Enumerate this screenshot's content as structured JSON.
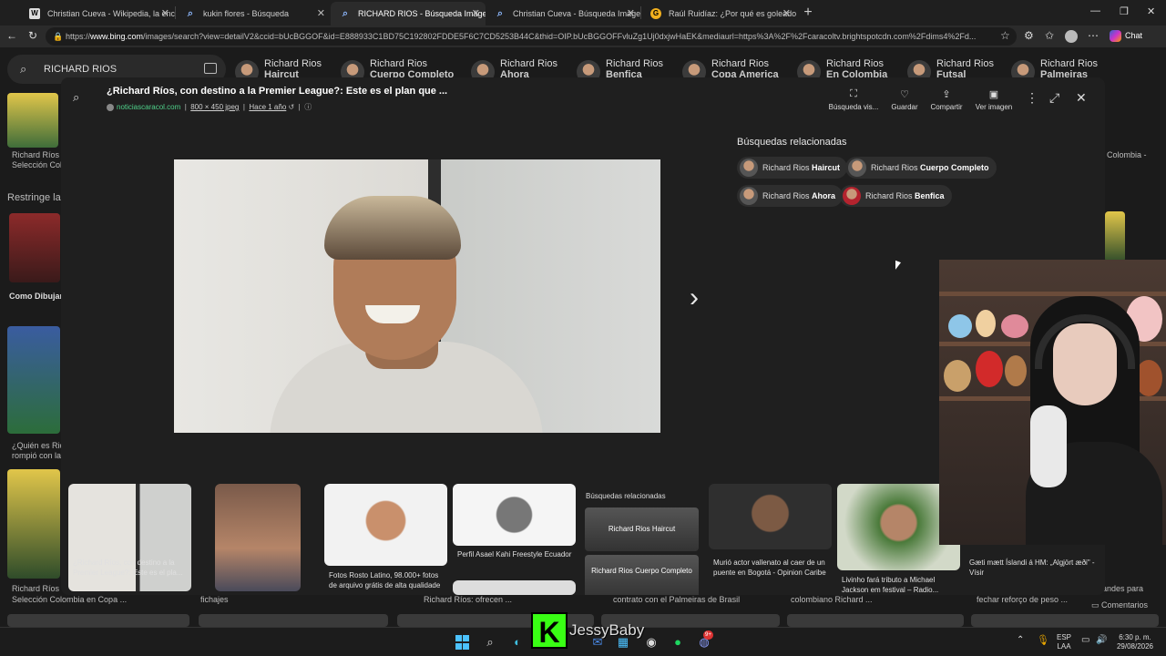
{
  "tabs": [
    {
      "label": "Christian Cueva - Wikipedia, la enc",
      "favicon": "W"
    },
    {
      "label": "kukin flores - Búsqueda",
      "favicon": "search-icon"
    },
    {
      "label": "RICHARD RIOS - Búsqueda Imágen",
      "favicon": "search-icon",
      "active": true
    },
    {
      "label": "Christian Cueva - Búsqueda Imáge",
      "favicon": "search-icon"
    },
    {
      "label": "Raúl Ruidíaz: ¿Por qué es goleador",
      "favicon": "gold"
    }
  ],
  "address": {
    "url_prefix": "https://",
    "url_host": "www.bing.com",
    "url_rest": "/images/search?view=detailV2&ccid=bUcBGGOF&id=E888933C1BD75C192802FDDE5F6C7CD5253B44C&thid=OIP.bUcBGGOFFvluZg1Uj0dxjwHaEK&mediaurl=https%3A%2F%2Fcaracoltv.brightspotcdn.com%2Fdims4%2Fd..."
  },
  "copilot_label": "Chat",
  "bing": {
    "query": "RICHARD RIOS",
    "chips": [
      {
        "name": "Richard Rios",
        "sub": "Haircut"
      },
      {
        "name": "Richard Rios",
        "sub": "Cuerpo Completo"
      },
      {
        "name": "Richard Rios",
        "sub": "Ahora"
      },
      {
        "name": "Richard Rios",
        "sub": "Benfica"
      },
      {
        "name": "Richard Rios",
        "sub": "Copa America"
      },
      {
        "name": "Richard Rios",
        "sub": "En Colombia"
      },
      {
        "name": "Richard Rios",
        "sub": "Futsal"
      },
      {
        "name": "Richard Rios",
        "sub": "Palmeiras"
      }
    ],
    "bg_texts": {
      "left1": "Richard Ríos",
      "left2": "Selección Col",
      "restrict": "Restringe la",
      "como": "Como Dibujar",
      "quien1": "¿Quién es Ric",
      "quien2": "rompió con la",
      "bottom1": "Richard Ríos",
      "bottom2": "Selección Colombia en Copa ...",
      "bottom3": "fichajes",
      "bottom4": "Richard Ríos: ofrecen ...",
      "bottom5": "contrato con el Palmeiras de Brasil",
      "bottom6": "colombiano Richard ...",
      "bottom7": "fechar reforço de peso ...",
      "right1": "Colombia -",
      "right2": "andes para",
      "comentarios": "Comentarios"
    }
  },
  "modal": {
    "title": "¿Richard Ríos, con destino a la Premier League?: Este es el plan que ...",
    "source": "noticiascaracol.com",
    "dims": "800 × 450 jpeg",
    "age": "Hace 1 año",
    "actions": [
      {
        "label": "Búsqueda vis...",
        "icon": "visual-search-icon"
      },
      {
        "label": "Guardar",
        "icon": "save-icon"
      },
      {
        "label": "Compartir",
        "icon": "share-icon"
      },
      {
        "label": "Ver imagen",
        "icon": "view-image-icon"
      }
    ],
    "related_title": "Búsquedas relacionadas",
    "related": [
      {
        "name": "Richard Rios",
        "sub": "Haircut"
      },
      {
        "name": "Richard Rios",
        "sub": "Cuerpo Completo"
      },
      {
        "name": "Richard Rios",
        "sub": "Ahora"
      },
      {
        "name": "Richard Rios",
        "sub": "Benfica"
      }
    ],
    "strip": [
      {
        "caption": "¿Richard Ríos, con destino a la Premier League?: Este es el pla..."
      },
      {
        "caption": ""
      },
      {
        "caption": "Fotos Rosto Latino, 98.000+ fotos de arquivo grátis de alta qualidade"
      },
      {
        "caption": "Perfil Asael Kahi Freestyle Ecuador"
      },
      {
        "caption": "Murió actor vallenato al caer de un puente en Bogotá - Opinion Caribe"
      },
      {
        "caption": "Livinho fará tributo a Michael Jackson em festival – Radio..."
      },
      {
        "caption": "Gæti mætt Íslandi á HM: „Algjört æði\" - Vísir"
      }
    ],
    "strip_related_title": "Búsquedas relacionadas",
    "strip_related": [
      "Richard Rios Haircut",
      "Richard Rios Cuerpo Completo"
    ]
  },
  "stream": {
    "name": "JessyBaby",
    "logo": "K"
  },
  "taskbar": {
    "lang1": "ESP",
    "lang2": "LAA",
    "time": "6:30 p. m.",
    "date": "29/08/2026",
    "badge": "9+"
  }
}
